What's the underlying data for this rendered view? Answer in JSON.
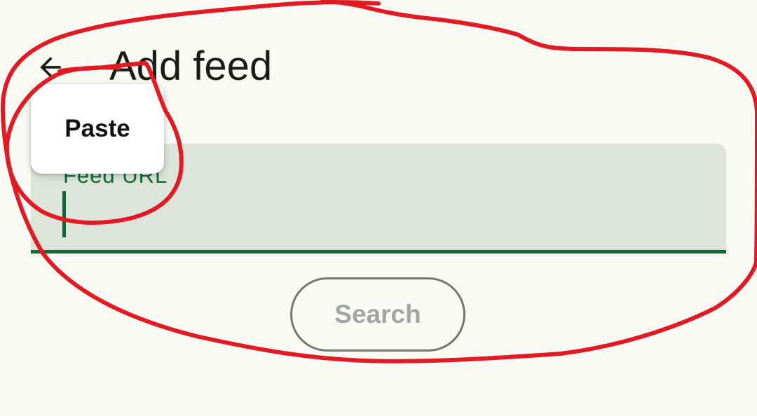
{
  "app_bar": {
    "title": "Add feed",
    "back_icon": "arrow-back-icon"
  },
  "feed_url_field": {
    "label": "Feed URL",
    "value": ""
  },
  "context_menu": {
    "paste_label": "Paste"
  },
  "search_button": {
    "label": "Search"
  },
  "colors": {
    "background": "#fafaf5",
    "field_background": "#dde5da",
    "accent_green": "#0b6b35",
    "title_text": "#1b1c18",
    "disabled_text": "#a3a5a0",
    "button_outline": "#74786f",
    "annotation_red": "#e01b24"
  }
}
